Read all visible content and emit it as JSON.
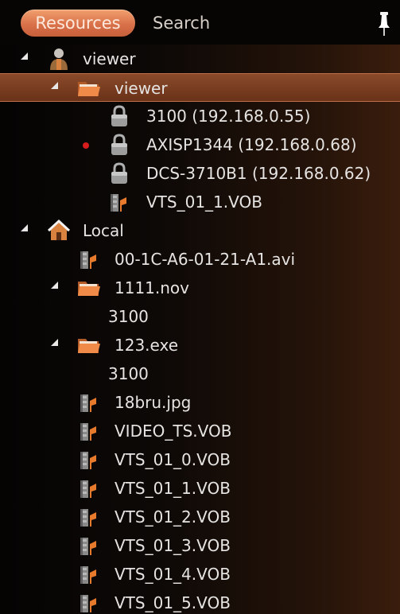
{
  "tabs": [
    {
      "label": "Resources",
      "active": true
    },
    {
      "label": "Search",
      "active": false
    }
  ],
  "tree": [
    {
      "label": "viewer",
      "icon": "user-icon",
      "level": 0,
      "expanded": true
    },
    {
      "label": "viewer",
      "icon": "folder-icon",
      "level": 1,
      "expanded": true,
      "selected": true
    },
    {
      "label": "3100 (192.168.0.55)",
      "icon": "lock-icon",
      "level": 2
    },
    {
      "label": "AXISP1344 (192.168.0.68)",
      "icon": "lock-icon",
      "level": 2,
      "recording": true
    },
    {
      "label": "DCS-3710B1 (192.168.0.62)",
      "icon": "lock-icon",
      "level": 2
    },
    {
      "label": "VTS_01_1.VOB",
      "icon": "video-file-icon",
      "level": 2
    },
    {
      "label": "Local",
      "icon": "home-icon",
      "level": 0,
      "expanded": true
    },
    {
      "label": "00-1C-A6-01-21-A1.avi",
      "icon": "video-file-icon",
      "level": 1
    },
    {
      "label": "1111.nov",
      "icon": "folder-icon",
      "level": 1,
      "expanded": true
    },
    {
      "label": "3100",
      "icon": "",
      "level": 2
    },
    {
      "label": "123.exe",
      "icon": "folder-icon",
      "level": 1,
      "expanded": true
    },
    {
      "label": "3100",
      "icon": "",
      "level": 2
    },
    {
      "label": "18bru.jpg",
      "icon": "video-file-icon",
      "level": 1
    },
    {
      "label": "VIDEO_TS.VOB",
      "icon": "video-file-icon",
      "level": 1
    },
    {
      "label": "VTS_01_0.VOB",
      "icon": "video-file-icon",
      "level": 1
    },
    {
      "label": "VTS_01_1.VOB",
      "icon": "video-file-icon",
      "level": 1
    },
    {
      "label": "VTS_01_2.VOB",
      "icon": "video-file-icon",
      "level": 1
    },
    {
      "label": "VTS_01_3.VOB",
      "icon": "video-file-icon",
      "level": 1
    },
    {
      "label": "VTS_01_4.VOB",
      "icon": "video-file-icon",
      "level": 1
    },
    {
      "label": "VTS_01_5.VOB",
      "icon": "video-file-icon",
      "level": 1
    }
  ],
  "colors": {
    "accent": "#d9714a",
    "selected_row": "#7a3e22",
    "recording_dot": "#d61c1c",
    "text": "#e6e4e2"
  }
}
